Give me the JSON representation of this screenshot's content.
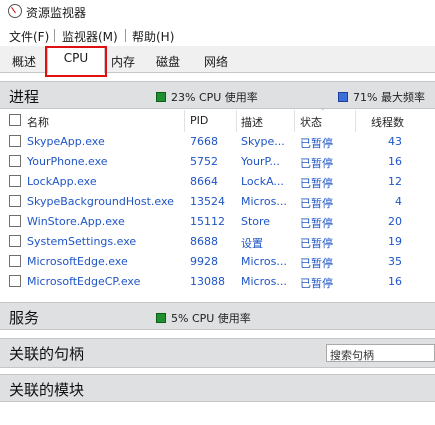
{
  "window": {
    "title": "资源监视器"
  },
  "menu": {
    "items": [
      "文件(F)",
      "监视器(M)",
      "帮助(H)"
    ]
  },
  "tabs": [
    "概述",
    "CPU",
    "内存",
    "磁盘",
    "网络"
  ],
  "process_section": {
    "title": "进程",
    "cpu_usage": "23% CPU 使用率",
    "max_freq": "71% 最大频率",
    "colors": {
      "cpu": "#1f8f2f",
      "freq": "#3d6fd9"
    },
    "columns": [
      "名称",
      "PID",
      "描述",
      "状态",
      "线程数"
    ],
    "rows": [
      {
        "name": "SkypeApp.exe",
        "pid": "7668",
        "desc": "Skype...",
        "status": "已暂停",
        "threads": "43"
      },
      {
        "name": "YourPhone.exe",
        "pid": "5752",
        "desc": "YourP...",
        "status": "已暂停",
        "threads": "16"
      },
      {
        "name": "LockApp.exe",
        "pid": "8664",
        "desc": "LockA...",
        "status": "已暂停",
        "threads": "12"
      },
      {
        "name": "SkypeBackgroundHost.exe",
        "pid": "13524",
        "desc": "Micros...",
        "status": "已暂停",
        "threads": "4"
      },
      {
        "name": "WinStore.App.exe",
        "pid": "15112",
        "desc": "Store",
        "status": "已暂停",
        "threads": "20"
      },
      {
        "name": "SystemSettings.exe",
        "pid": "8688",
        "desc": "设置",
        "status": "已暂停",
        "threads": "19"
      },
      {
        "name": "MicrosoftEdge.exe",
        "pid": "9928",
        "desc": "Micros...",
        "status": "已暂停",
        "threads": "35"
      },
      {
        "name": "MicrosoftEdgeCP.exe",
        "pid": "13088",
        "desc": "Micros...",
        "status": "已暂停",
        "threads": "16"
      }
    ]
  },
  "services_section": {
    "title": "服务",
    "cpu_usage": "5% CPU 使用率"
  },
  "handles_section": {
    "title": "关联的句柄",
    "search_placeholder": "搜索句柄"
  },
  "modules_section": {
    "title": "关联的模块"
  }
}
